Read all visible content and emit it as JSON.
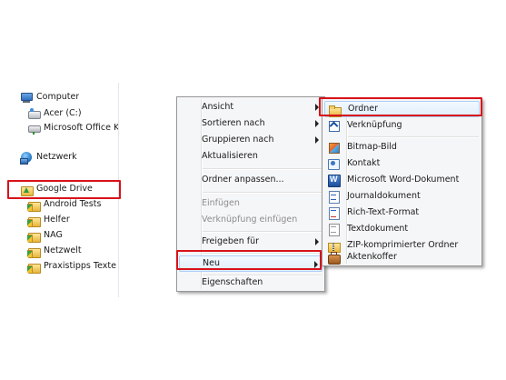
{
  "nav_pane": {
    "computer": "Computer",
    "drive_c": "Acer (C:)",
    "office": "Microsoft Office Kli",
    "network": "Netzwerk",
    "google_drive": "Google Drive",
    "children": [
      "Android Tests",
      "Helfer",
      "NAG",
      "Netzwelt",
      "Praxistipps Texte"
    ]
  },
  "context_menu": {
    "items": {
      "ansicht": "Ansicht",
      "sortieren": "Sortieren nach",
      "gruppieren": "Gruppieren nach",
      "aktualisieren": "Aktualisieren",
      "anpassen": "Ordner anpassen...",
      "einfuegen": "Einfügen",
      "verknuepfung_einfuegen": "Verknüpfung einfügen",
      "freigeben": "Freigeben für",
      "neu": "Neu",
      "eigenschaften": "Eigenschaften"
    }
  },
  "submenu_new": {
    "items": [
      {
        "label": "Ordner",
        "icon": "folder-icon"
      },
      {
        "label": "Verknüpfung",
        "icon": "shortcut-icon"
      },
      {
        "label": "Bitmap-Bild",
        "icon": "bitmap-icon"
      },
      {
        "label": "Kontakt",
        "icon": "contact-icon"
      },
      {
        "label": "Microsoft Word-Dokument",
        "icon": "word-document-icon"
      },
      {
        "label": "Journaldokument",
        "icon": "journal-icon"
      },
      {
        "label": "Rich-Text-Format",
        "icon": "rich-text-icon"
      },
      {
        "label": "Textdokument",
        "icon": "text-document-icon"
      },
      {
        "label": "ZIP-komprimierter Ordner",
        "icon": "zip-folder-icon"
      },
      {
        "label": "Aktenkoffer",
        "icon": "briefcase-icon"
      }
    ]
  },
  "colors": {
    "highlight_box": "#d9121a",
    "menu_background": "#f5f6f7"
  }
}
